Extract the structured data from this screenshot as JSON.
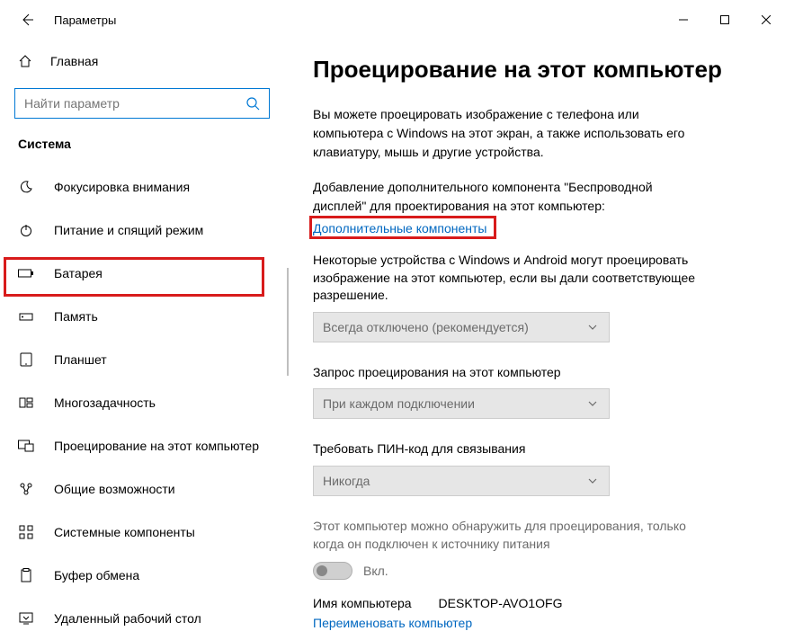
{
  "window": {
    "title": "Параметры"
  },
  "sidebar": {
    "home": "Главная",
    "search_placeholder": "Найти параметр",
    "category": "Система",
    "items": [
      {
        "label": "Фокусировка внимания"
      },
      {
        "label": "Питание и спящий режим"
      },
      {
        "label": "Батарея"
      },
      {
        "label": "Память"
      },
      {
        "label": "Планшет"
      },
      {
        "label": "Многозадачность"
      },
      {
        "label": "Проецирование на этот компьютер"
      },
      {
        "label": "Общие возможности"
      },
      {
        "label": "Системные компоненты"
      },
      {
        "label": "Буфер обмена"
      },
      {
        "label": "Удаленный рабочий стол"
      }
    ]
  },
  "main": {
    "heading": "Проецирование на этот компьютер",
    "intro": "Вы можете проецировать изображение с телефона или компьютера с Windows на этот экран, а также использовать его клавиатуру, мышь и другие устройства.",
    "add_feature_text": "Добавление дополнительного компонента \"Беспроводной дисплей\" для проектирования на этот компьютер:",
    "optional_features_link": "Дополнительные компоненты",
    "setting1": {
      "label": "Некоторые устройства с Windows и Android могут проецировать изображение на этот компьютер, если вы дали соответствующее разрешение.",
      "value": "Всегда отключено (рекомендуется)"
    },
    "setting2": {
      "label": "Запрос проецирования на этот компьютер",
      "value": "При каждом подключении"
    },
    "setting3": {
      "label": "Требовать ПИН-код для связывания",
      "value": "Никогда"
    },
    "discovery_text": "Этот компьютер можно обнаружить для проецирования, только когда он подключен к источнику питания",
    "toggle_label": "Вкл.",
    "pc_name_label": "Имя компьютера",
    "pc_name_value": "DESKTOP-AVO1OFG",
    "rename_link": "Переименовать компьютер"
  }
}
